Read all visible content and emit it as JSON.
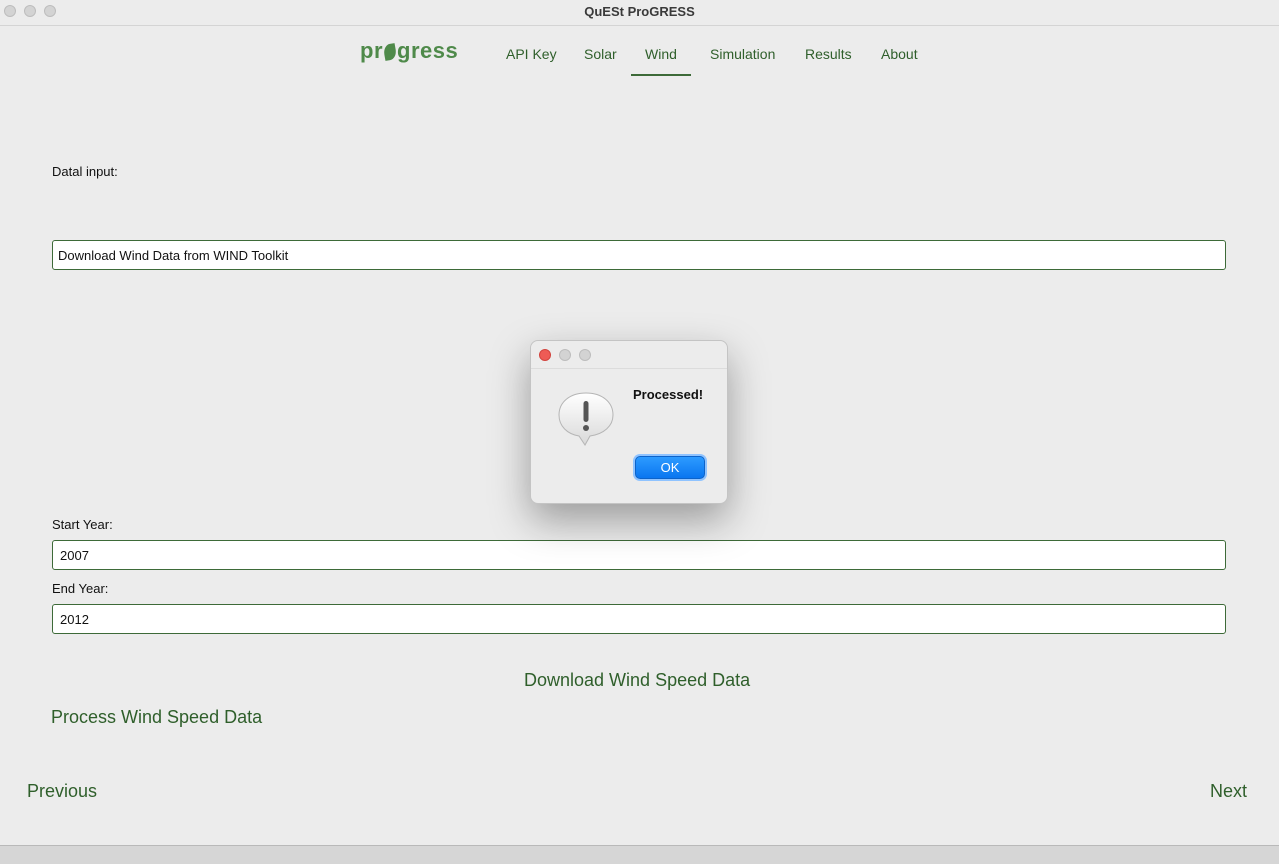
{
  "window": {
    "title": "QuESt ProGRESS"
  },
  "nav": {
    "logo": {
      "prefix": "pr",
      "suffix": "gress"
    },
    "tabs": [
      {
        "label": "API Key"
      },
      {
        "label": "Solar"
      },
      {
        "label": "Wind"
      },
      {
        "label": "Simulation"
      },
      {
        "label": "Results"
      },
      {
        "label": "About"
      }
    ],
    "active_tab": "Wind"
  },
  "form": {
    "data_input_label": "Datal input:",
    "data_source_value": "Download Wind Data from WIND Toolkit",
    "start_year_label": "Start Year:",
    "start_year_value": "2007",
    "end_year_label": "End Year:",
    "end_year_value": "2012",
    "download_button": "Download Wind Speed Data",
    "process_button": "Process Wind Speed Data"
  },
  "footer": {
    "previous": "Previous",
    "next": "Next"
  },
  "dialog": {
    "message": "Processed!",
    "ok_label": "OK",
    "icon": "exclamation-bubble-icon"
  },
  "colors": {
    "accent_green": "#2f5f2b",
    "ok_blue": "#0a76f0",
    "close_red": "#ee5b55"
  }
}
